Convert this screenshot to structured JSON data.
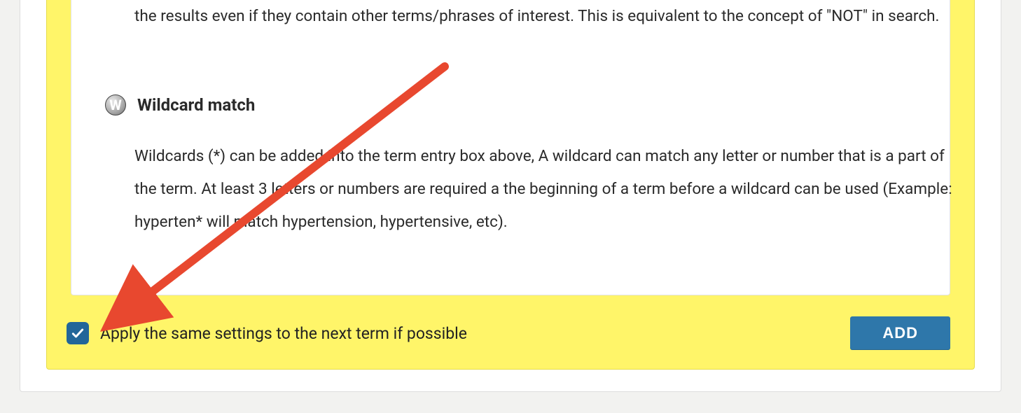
{
  "sections": {
    "not_description": "the results even if they contain other terms/phrases of interest. This is equivalent to the concept of \"NOT\" in search.",
    "wildcard": {
      "icon_letter": "W",
      "title": "Wildcard match",
      "description": "Wildcards (*) can be added into the term entry box above, A wildcard can match any letter or number that is a part of the term. At least 3 letters or numbers are required a the beginning of a term before a wildcard can be used (Example: hyperten* will match hypertension, hypertensive, etc)."
    }
  },
  "footer": {
    "apply_label": "Apply the same settings to the next term if possible",
    "checked": true,
    "add_label": "ADD"
  }
}
